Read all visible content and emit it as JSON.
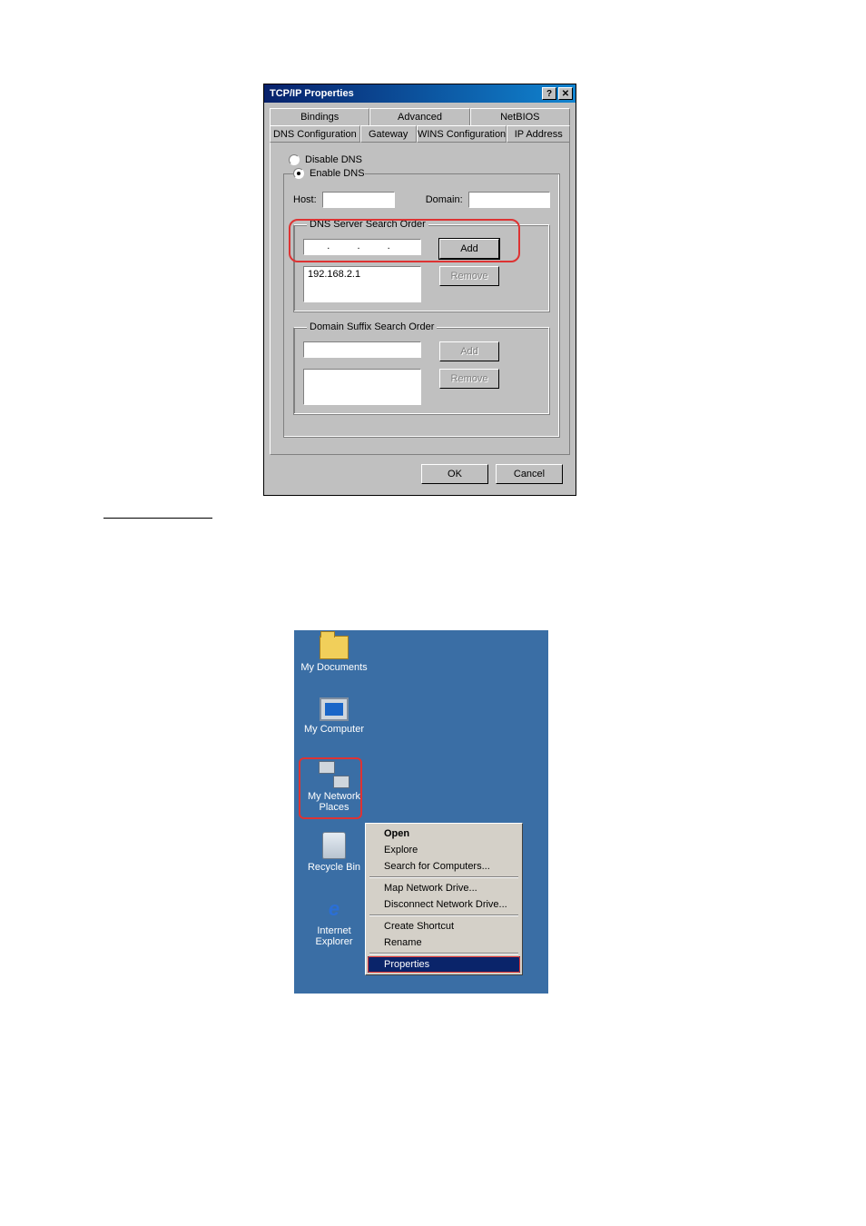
{
  "dialog": {
    "title": "TCP/IP Properties",
    "tabs_top": [
      "Bindings",
      "Advanced",
      "NetBIOS"
    ],
    "tabs_bottom": [
      "DNS Configuration",
      "Gateway",
      "WINS Configuration",
      "IP Address"
    ],
    "active_tab": "DNS Configuration",
    "radio_disable": "Disable DNS",
    "radio_enable": "Enable DNS",
    "host_label": "Host:",
    "domain_label": "Domain:",
    "group_dns": "DNS Server Search Order",
    "dns_list_item": "192.168.2.1",
    "group_suffix": "Domain Suffix Search Order",
    "btn_add": "Add",
    "btn_remove": "Remove",
    "btn_ok": "OK",
    "btn_cancel": "Cancel"
  },
  "desktop": {
    "icons": {
      "documents": "My Documents",
      "computer": "My Computer",
      "network": "My Network Places",
      "recycle": "Recycle Bin",
      "ie": "Internet Explorer"
    },
    "menu": {
      "open": "Open",
      "explore": "Explore",
      "search": "Search for Computers...",
      "map": "Map Network Drive...",
      "disconnect": "Disconnect Network Drive...",
      "shortcut": "Create Shortcut",
      "rename": "Rename",
      "properties": "Properties"
    }
  }
}
